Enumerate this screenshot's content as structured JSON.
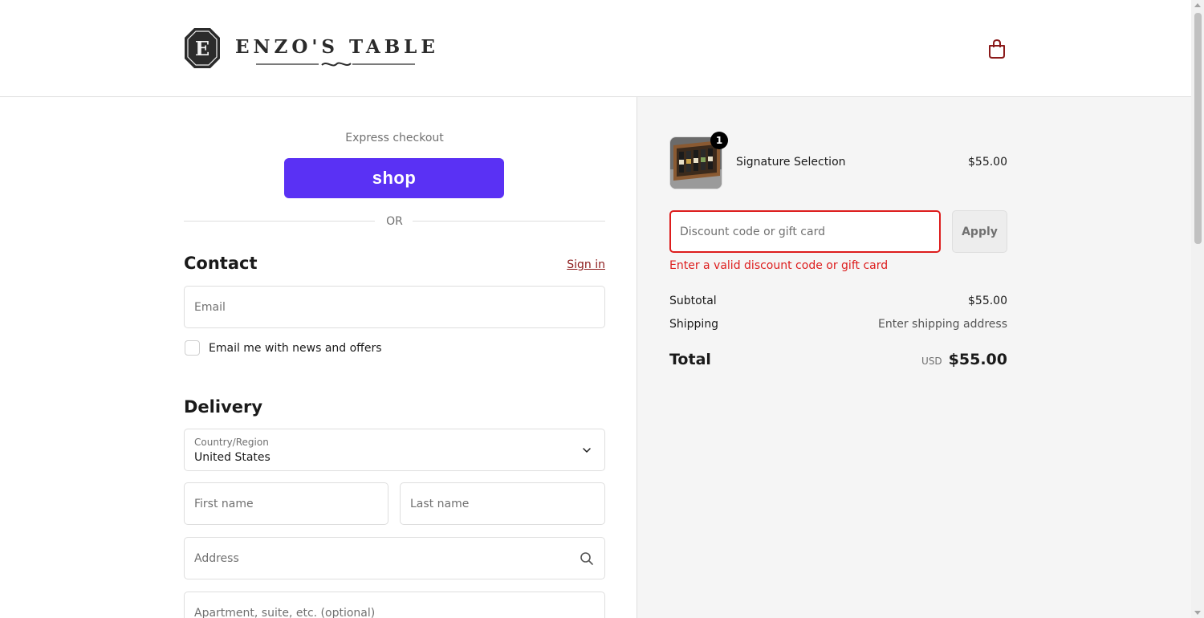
{
  "brand": {
    "logo_mark_letter": "E",
    "logo_text": "ENZO'S TABLE",
    "cart_icon": "shopping-bag-icon",
    "accent_color": "#8b1a1a"
  },
  "express": {
    "label": "Express checkout",
    "shop_pay_label": "shop",
    "shop_pay_color": "#5a31f4",
    "divider_text": "OR"
  },
  "contact": {
    "title": "Contact",
    "sign_in_label": "Sign in",
    "email_placeholder": "Email",
    "newsletter_label": "Email me with news and offers",
    "newsletter_checked": false
  },
  "delivery": {
    "title": "Delivery",
    "country_label": "Country/Region",
    "country_value": "United States",
    "first_name_placeholder": "First name",
    "last_name_placeholder": "Last name",
    "address_placeholder": "Address",
    "apartment_placeholder": "Apartment, suite, etc. (optional)"
  },
  "summary": {
    "product": {
      "name": "Signature Selection",
      "price": "$55.00",
      "quantity": "1"
    },
    "discount": {
      "placeholder": "Discount code or gift card",
      "apply_label": "Apply",
      "error": "Enter a valid discount code or gift card",
      "error_color": "#dd1d1d"
    },
    "subtotal_label": "Subtotal",
    "subtotal_value": "$55.00",
    "shipping_label": "Shipping",
    "shipping_value": "Enter shipping address",
    "total_label": "Total",
    "total_currency": "USD",
    "total_value": "$55.00"
  }
}
